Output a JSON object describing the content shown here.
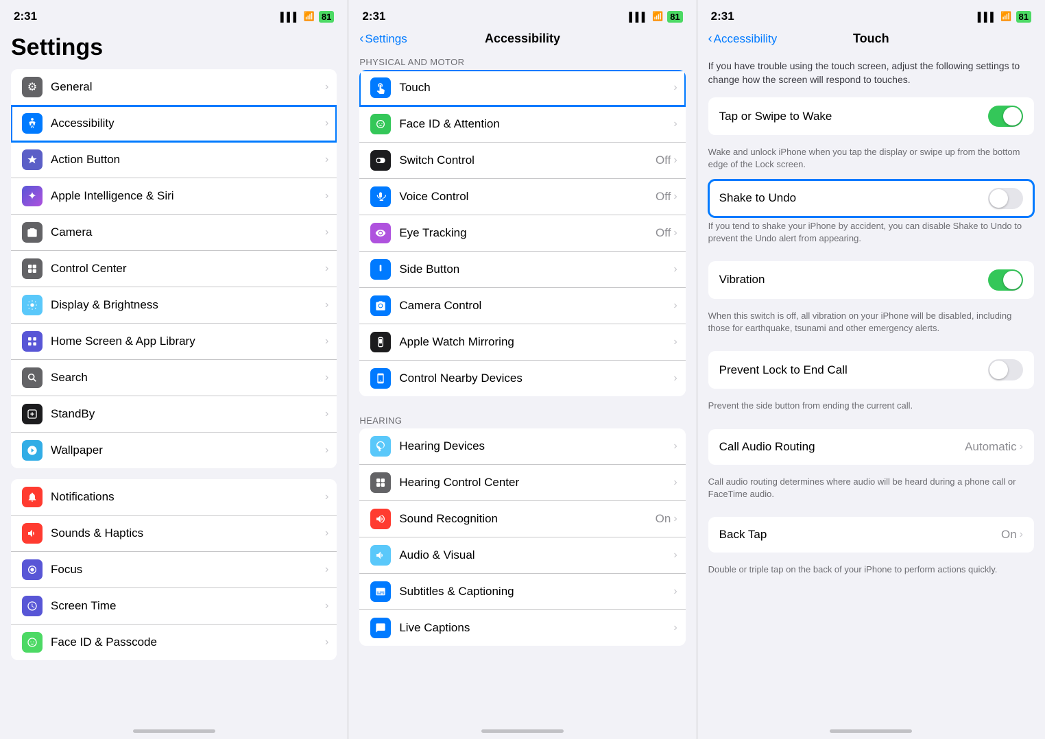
{
  "panel1": {
    "statusTime": "2:31",
    "signal": "▌▌▌",
    "wifi": "WiFi",
    "battery": "81",
    "title": "Settings",
    "items": [
      {
        "label": "General",
        "icon": "⚙",
        "iconBg": "bg-gray2",
        "id": "general"
      },
      {
        "label": "Accessibility",
        "icon": "♿",
        "iconBg": "bg-accessibility",
        "id": "accessibility",
        "selected": true
      },
      {
        "label": "Action Button",
        "icon": "★",
        "iconBg": "bg-blue",
        "id": "action-button"
      },
      {
        "label": "Apple Intelligence & Siri",
        "icon": "✦",
        "iconBg": "bg-indigo",
        "id": "siri"
      },
      {
        "label": "Camera",
        "icon": "📷",
        "iconBg": "bg-gray2",
        "id": "camera"
      },
      {
        "label": "Control Center",
        "icon": "⊞",
        "iconBg": "bg-gray2",
        "id": "control-center"
      },
      {
        "label": "Display & Brightness",
        "icon": "☀",
        "iconBg": "bg-blue2",
        "id": "display"
      },
      {
        "label": "Home Screen & App Library",
        "icon": "⊞",
        "iconBg": "bg-indigo",
        "id": "home-screen"
      },
      {
        "label": "Search",
        "icon": "🔍",
        "iconBg": "bg-gray2",
        "id": "search"
      },
      {
        "label": "StandBy",
        "icon": "⊡",
        "iconBg": "bg-dark",
        "id": "standby"
      },
      {
        "label": "Wallpaper",
        "icon": "❀",
        "iconBg": "bg-cyan",
        "id": "wallpaper"
      },
      {
        "label": "Notifications",
        "icon": "🔔",
        "iconBg": "bg-red",
        "id": "notifications"
      },
      {
        "label": "Sounds & Haptics",
        "icon": "🔊",
        "iconBg": "bg-red",
        "id": "sounds"
      },
      {
        "label": "Focus",
        "icon": "🌙",
        "iconBg": "bg-indigo",
        "id": "focus"
      },
      {
        "label": "Screen Time",
        "icon": "⌛",
        "iconBg": "bg-indigo",
        "id": "screen-time"
      },
      {
        "label": "Face ID & Passcode",
        "icon": "👤",
        "iconBg": "bg-green",
        "id": "faceid"
      }
    ]
  },
  "panel2": {
    "statusTime": "2:31",
    "battery": "81",
    "backLabel": "Settings",
    "title": "Accessibility",
    "sectionPhysical": "PHYSICAL AND MOTOR",
    "sectionHearing": "HEARING",
    "physicalItems": [
      {
        "label": "Touch",
        "icon": "👆",
        "iconBg": "bg-blue",
        "id": "touch",
        "selected": true
      },
      {
        "label": "Face ID & Attention",
        "icon": "👁",
        "iconBg": "bg-teal",
        "id": "faceid-attention"
      },
      {
        "label": "Switch Control",
        "icon": "⊞",
        "iconBg": "bg-dark",
        "id": "switch-control",
        "value": "Off"
      },
      {
        "label": "Voice Control",
        "icon": "🎙",
        "iconBg": "bg-blue",
        "id": "voice-control",
        "value": "Off"
      },
      {
        "label": "Eye Tracking",
        "icon": "👁",
        "iconBg": "bg-purple",
        "id": "eye-tracking",
        "value": "Off"
      },
      {
        "label": "Side Button",
        "icon": "▐",
        "iconBg": "bg-blue",
        "id": "side-button"
      },
      {
        "label": "Camera Control",
        "icon": "📷",
        "iconBg": "bg-blue",
        "id": "camera-control"
      },
      {
        "label": "Apple Watch Mirroring",
        "icon": "⌚",
        "iconBg": "bg-dark",
        "id": "watch-mirror"
      },
      {
        "label": "Control Nearby Devices",
        "icon": "📱",
        "iconBg": "bg-blue",
        "id": "control-nearby"
      }
    ],
    "hearingItems": [
      {
        "label": "Hearing Devices",
        "icon": "👂",
        "iconBg": "bg-blue2",
        "id": "hearing-devices"
      },
      {
        "label": "Hearing Control Center",
        "icon": "⊞",
        "iconBg": "bg-gray2",
        "id": "hearing-cc"
      },
      {
        "label": "Sound Recognition",
        "icon": "🔊",
        "iconBg": "bg-red",
        "id": "sound-recognition",
        "value": "On"
      },
      {
        "label": "Audio & Visual",
        "icon": "🔊",
        "iconBg": "bg-blue2",
        "id": "audio-visual"
      },
      {
        "label": "Subtitles & Captioning",
        "icon": "💬",
        "iconBg": "bg-blue",
        "id": "subtitles"
      },
      {
        "label": "Live Captions",
        "icon": "💬",
        "iconBg": "bg-blue",
        "id": "live-captions"
      }
    ]
  },
  "panel3": {
    "statusTime": "2:31",
    "battery": "81",
    "backLabel": "Accessibility",
    "title": "Touch",
    "intro": "If you have trouble using the touch screen, adjust the following settings to change how the screen will respond to touches.",
    "settings": [
      {
        "label": "Tap or Swipe to Wake",
        "toggleOn": true,
        "desc": "Wake and unlock iPhone when you tap the display or swipe up from the bottom edge of the Lock screen."
      },
      {
        "label": "Shake to Undo",
        "toggleOn": false,
        "highlighted": true,
        "desc": "If you tend to shake your iPhone by accident, you can disable Shake to Undo to prevent the Undo alert from appearing."
      },
      {
        "label": "Vibration",
        "toggleOn": true,
        "desc": "When this switch is off, all vibration on your iPhone will be disabled, including those for earthquake, tsunami and other emergency alerts."
      },
      {
        "label": "Prevent Lock to End Call",
        "toggleOn": false,
        "desc": "Prevent the side button from ending the current call."
      },
      {
        "label": "Call Audio Routing",
        "value": "Automatic",
        "desc": "Call audio routing determines where audio will be heard during a phone call or FaceTime audio."
      },
      {
        "label": "Back Tap",
        "value": "On",
        "desc": "Double or triple tap on the back of your iPhone to perform actions quickly."
      }
    ]
  },
  "icons": {
    "chevron": "›",
    "chevronBack": "‹"
  }
}
